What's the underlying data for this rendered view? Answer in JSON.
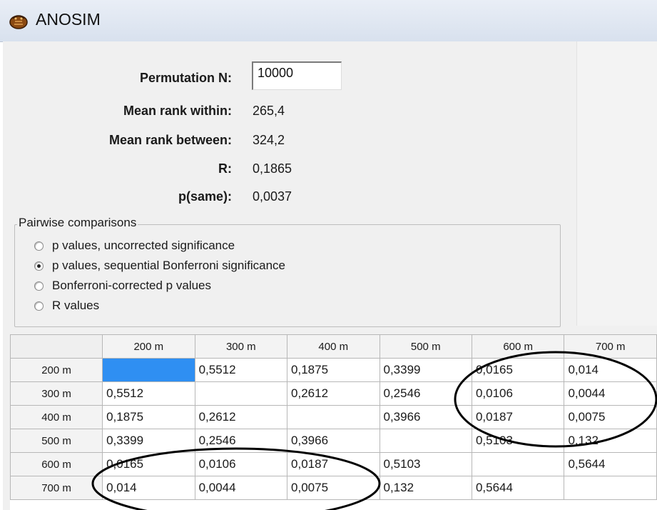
{
  "window": {
    "title": "ANOSIM",
    "icon": "trilobite-icon"
  },
  "stats": {
    "permutation_label": "Permutation N:",
    "permutation_value": "10000",
    "mean_within_label": "Mean rank within:",
    "mean_within_value": "265,4",
    "mean_between_label": "Mean rank between:",
    "mean_between_value": "324,2",
    "r_label": "R:",
    "r_value": "0,1865",
    "psame_label": "p(same):",
    "psame_value": "0,0037"
  },
  "pairwise": {
    "legend": "Pairwise comparisons",
    "options": [
      {
        "label": "p values, uncorrected significance",
        "selected": false
      },
      {
        "label": "p values, sequential Bonferroni significance",
        "selected": true
      },
      {
        "label": "Bonferroni-corrected p values",
        "selected": false
      },
      {
        "label": "R values",
        "selected": false
      }
    ]
  },
  "table": {
    "headers": [
      "200 m",
      "300 m",
      "400 m",
      "500 m",
      "600 m",
      "700 m"
    ],
    "rows": [
      {
        "label": "200 m",
        "cells": [
          "",
          "0,5512",
          "0,1875",
          "0,3399",
          "0,0165",
          "0,014"
        ]
      },
      {
        "label": "300 m",
        "cells": [
          "0,5512",
          "",
          "0,2612",
          "0,2546",
          "0,0106",
          "0,0044"
        ]
      },
      {
        "label": "400 m",
        "cells": [
          "0,1875",
          "0,2612",
          "",
          "0,3966",
          "0,0187",
          "0,0075"
        ]
      },
      {
        "label": "500 m",
        "cells": [
          "0,3399",
          "0,2546",
          "0,3966",
          "",
          "0,5103",
          "0,132"
        ]
      },
      {
        "label": "600 m",
        "cells": [
          "0,0165",
          "0,0106",
          "0,0187",
          "0,5103",
          "",
          "0,5644"
        ]
      },
      {
        "label": "700 m",
        "cells": [
          "0,014",
          "0,0044",
          "0,0075",
          "0,132",
          "0,5644",
          ""
        ]
      }
    ],
    "selected_cell_color": "#2f8ff2"
  }
}
